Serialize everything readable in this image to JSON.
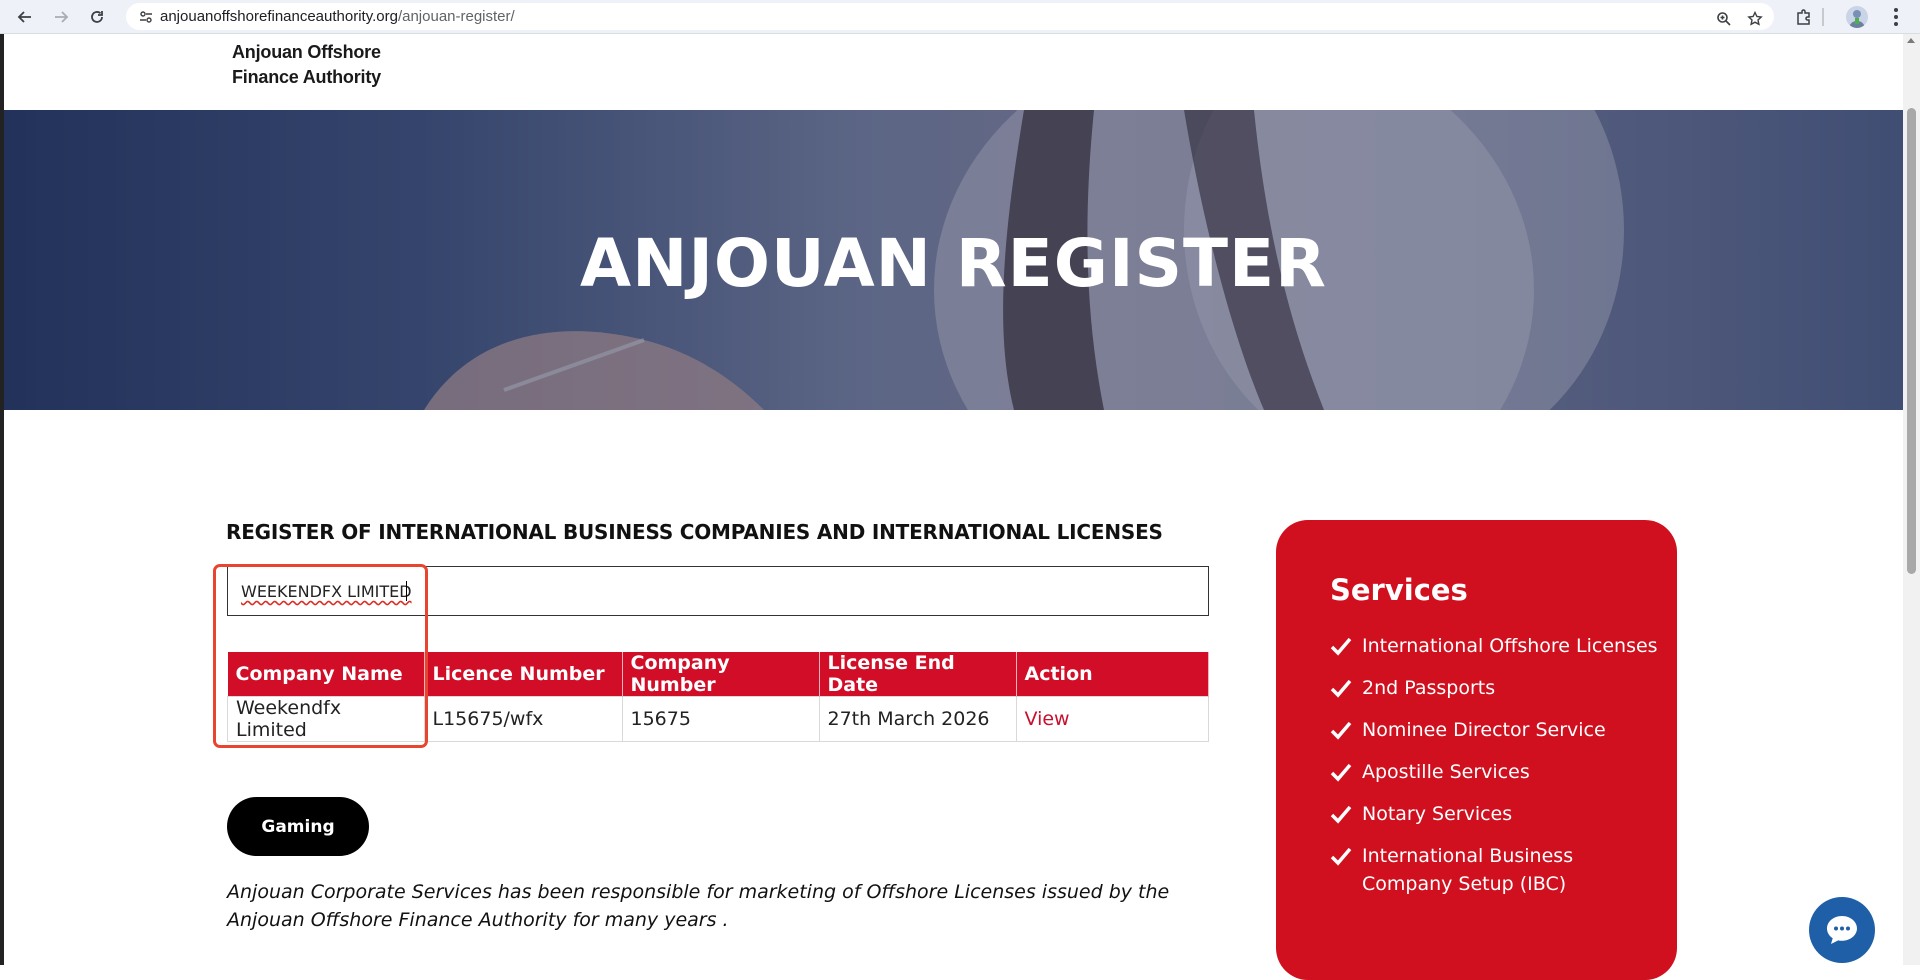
{
  "browser": {
    "url_domain": "anjouanoffshorefinanceauthority.org",
    "url_path": "/anjouan-register/"
  },
  "header": {
    "logo_line1": "Anjouan Offshore",
    "logo_line2": "Finance Authority"
  },
  "hero": {
    "title": "ANJOUAN REGISTER"
  },
  "main": {
    "heading": "REGISTER OF INTERNATIONAL BUSINESS COMPANIES AND INTERNATIONAL LICENSES",
    "search_value": "WEEKENDFX LIMITED",
    "table": {
      "columns": [
        "Company Name",
        "Licence Number",
        "Company Number",
        "License End Date",
        "Action"
      ],
      "rows": [
        [
          "Weekendfx Limited",
          "L15675/wfx",
          "15675",
          "27th March 2026",
          "View"
        ]
      ]
    },
    "gaming_label": "Gaming",
    "intro_text": "Anjouan Corporate Services has been responsible for marketing of Offshore Licenses issued by the Anjouan Offshore Finance Authority for many years ."
  },
  "services": {
    "title": "Services",
    "items": [
      "International Offshore Licenses",
      "2nd Passports",
      "Nominee Director Service",
      "Apostille Services",
      "Notary Services",
      "International Business Company Setup (IBC)"
    ]
  },
  "colors": {
    "accent_red": "#d10d27",
    "highlight": "#e8442f",
    "chat_blue": "#1e5fa8"
  }
}
